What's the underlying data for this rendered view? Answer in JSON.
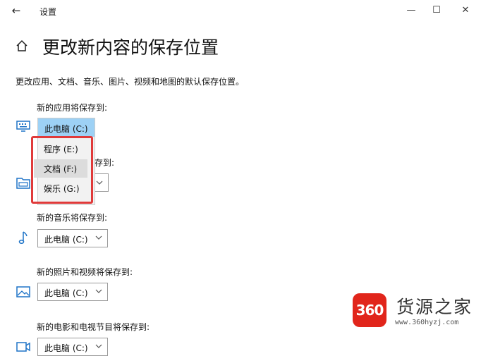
{
  "window": {
    "title": "设置",
    "back_glyph": "←",
    "minimize_glyph": "—",
    "maximize_glyph": "☐",
    "close_glyph": "✕"
  },
  "page": {
    "title": "更改新内容的保存位置",
    "description": "更改应用、文档、音乐、图片、视频和地图的默认保存位置。"
  },
  "rows": {
    "apps": {
      "label": "新的应用将保存到:",
      "value": "此电脑 (C:)",
      "icon": "monitor-icon"
    },
    "documents": {
      "label_suffix": "存到:",
      "icon": "folder-icon"
    },
    "music": {
      "label": "新的音乐将保存到:",
      "value": "此电脑 (C:)",
      "icon": "music-note-icon"
    },
    "photos": {
      "label": "新的照片和视频将保存到:",
      "value": "此电脑 (C:)",
      "icon": "picture-icon"
    },
    "movies": {
      "label": "新的电影和电视节目将保存到:",
      "value": "此电脑 (C:)",
      "icon": "video-icon"
    }
  },
  "dropdown": {
    "selected": "此电脑 (C:)",
    "options": [
      "程序 (E:)",
      "文档 (F:)",
      "娱乐 (G:)"
    ],
    "highlight_color": "#e03a3a",
    "selected_color": "#9dd1f5"
  },
  "watermark": {
    "logo_text": "360",
    "name": "货源之家",
    "url": "www.360hyzj.com",
    "logo_color": "#e1251b"
  }
}
